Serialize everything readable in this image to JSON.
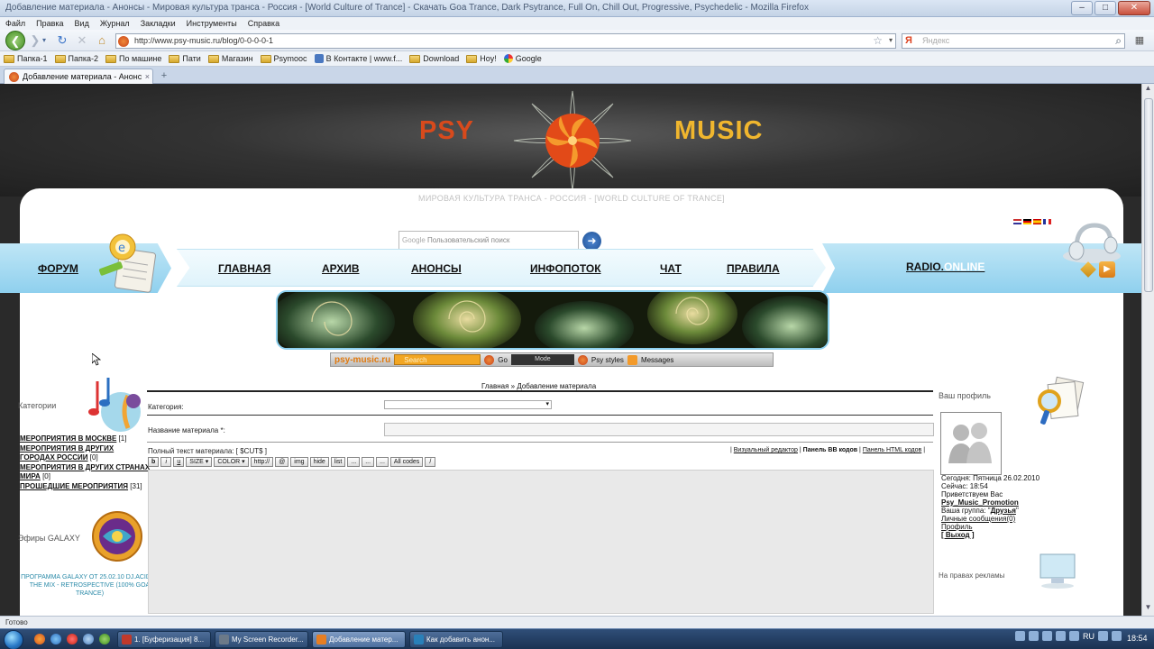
{
  "window": {
    "title": "Добавление материала - Анонсы - Мировая культура транса - Россия - [World Culture of Trance] - Скачать Goa Trance, Dark Psytrance, Full On, Chill Out, Progressive, Psychedelic - Mozilla Firefox",
    "min": "–",
    "max": "□",
    "close": "✕"
  },
  "menu": [
    "Файл",
    "Правка",
    "Вид",
    "Журнал",
    "Закладки",
    "Инструменты",
    "Справка"
  ],
  "nav": {
    "url": "http://www.psy-music.ru/blog/0-0-0-0-1",
    "search_placeholder": "Яндекс",
    "search_engine": "Я",
    "back": "❮",
    "forward": "❯",
    "reload": "↻",
    "stop": "✕",
    "home": "⌂",
    "star": "☆"
  },
  "bookmarks": [
    {
      "label": "Папка-1",
      "icon": "folder"
    },
    {
      "label": "Папка-2",
      "icon": "folder"
    },
    {
      "label": "По машине",
      "icon": "folder"
    },
    {
      "label": "Пати",
      "icon": "folder"
    },
    {
      "label": "Магазин",
      "icon": "folder"
    },
    {
      "label": "Psymooc",
      "icon": "folder"
    },
    {
      "label": "В Контакте | www.f...",
      "icon": "vk"
    },
    {
      "label": "Download",
      "icon": "folder"
    },
    {
      "label": "Hoy!",
      "icon": "folder"
    },
    {
      "label": "Google",
      "icon": "google"
    }
  ],
  "tab": {
    "label": "Добавление материала - Анонсы - М...",
    "close": "×",
    "new": "+"
  },
  "site": {
    "logo_left": "PSY",
    "logo_right": "MUSIC",
    "tagline": "МИРОВАЯ КУЛЬТУРА ТРАНСА - РОССИЯ - [WORLD CULTURE OF TRANCE]",
    "google_brand": "Google",
    "google_placeholder": "Пользовательский поиск",
    "go": "➜",
    "menu": {
      "forum": "ФОРУМ",
      "home": "ГЛАВНАЯ",
      "archive": "АРХИВ",
      "announce": "АНОНСЫ",
      "infoflow": "ИНФОПОТОК",
      "chat": "ЧАТ",
      "rules": "ПРАВИЛА",
      "radio_a": "RADIO.",
      "radio_b": "ONLINE",
      "play": "▶"
    },
    "toolbar": {
      "brand": "psy-music.ru",
      "search": "Search",
      "go": "Go",
      "mode": "Mode",
      "styles": "Psy styles",
      "messages": "Messages"
    }
  },
  "left": {
    "categories_title": "Категории",
    "categories": [
      {
        "name": "МЕРОПРИЯТИЯ В МОСКВЕ",
        "count": "[1]",
        "link": true
      },
      {
        "name": "МЕРОПРИЯТИЯ В ДРУГИХ ГОРОДАХ РОССИИ",
        "count": "[0]",
        "link": true
      },
      {
        "name": "МЕРОПРИЯТИЯ В ДРУГИХ СТРАНАХ МИРА",
        "count": "[0]",
        "link": true
      },
      {
        "name": "ПРОШЕДШИЕ МЕРОПРИЯТИЯ",
        "count": "[31]",
        "link": true
      }
    ],
    "galaxy_title": "Эфиры GALAXY",
    "galaxy_text": "ПРОГРАММА GALAXY ОТ 25.02.10 DJ.ACID IN THE MIX - RETROSPECTIVE (100% GOA TRANCE)"
  },
  "main": {
    "breadcrumb": "Главная » Добавление материала",
    "category_label": "Категория:",
    "title_label": "Название материала *:",
    "fulltext_label": "Полный текст материала: [ $CUT$ ]",
    "mode_visual": "Визуальный редактор",
    "mode_bb": "Панель BB кодов",
    "mode_html": "Панель HTML кодов",
    "bbcodes": [
      "b",
      "i",
      "u",
      "SIZE ▾",
      "COLOR ▾",
      "http://",
      "@",
      "img",
      "hide",
      "list",
      "...",
      "...",
      "...",
      "All codes",
      "/"
    ]
  },
  "right": {
    "profile_title": "Ваш профиль",
    "today": "Сегодня: Пятница 26.02.2010",
    "now": "Сейчас: 18:54",
    "greeting": "Приветствуем Вас",
    "user": "Psy_Music_Promotion",
    "group_label": "Ваша группа:",
    "group": "Друзья",
    "messages": "Личные сообщения(0)",
    "profile_link": "Профиль",
    "logout": "[ Выход ]",
    "bottom_title": "На правах рекламы"
  },
  "status": {
    "text": "Готово"
  },
  "taskbar": {
    "tasks": [
      {
        "label": "1. [Буферизация] 8...",
        "color": "#c0392b"
      },
      {
        "label": "My Screen Recorder...",
        "color": "#6c7a89"
      },
      {
        "label": "Добавление матер...",
        "color": "#e67e22",
        "active": true
      },
      {
        "label": "Как добавить анон...",
        "color": "#2980b9"
      }
    ],
    "lang": "RU",
    "clock": "18:54"
  }
}
